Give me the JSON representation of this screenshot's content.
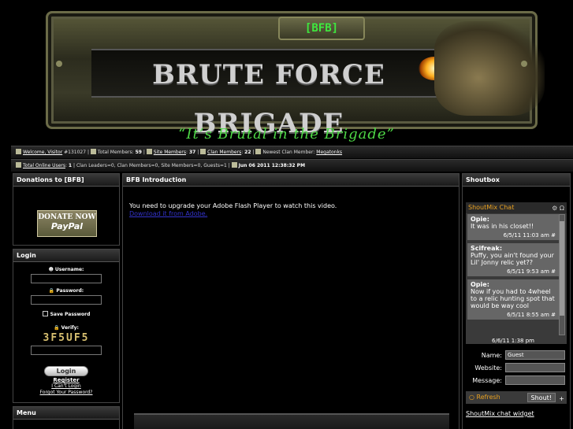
{
  "banner": {
    "tag": "[BFB]",
    "title": "BRUTE FORCE BRIGADE",
    "slogan": "“It’s Brutal in the Brigade”"
  },
  "infobar1": {
    "welcome": "Welcome, Visitor",
    "visitor_id": "#131027",
    "total_members_label": "Total Members:",
    "total_members": "59",
    "site_members_label": "Site Members",
    "site_members": "37",
    "clan_members_label": "Clan Members",
    "clan_members": "22",
    "newest_label": "Newest Clan Member:",
    "newest": "Megatonks"
  },
  "infobar2": {
    "online_label": "Total Online Users",
    "online": "1",
    "leaders": "Clan Leaders=0",
    "clan_members": "Clan Members=0",
    "site_members": "Site Members=0",
    "guests": "Guests=1",
    "datetime": "Jun 06 2011 12:38:32 PM"
  },
  "donate": {
    "title": "Donations to [BFB]",
    "btn_top": "DONATE NOW",
    "btn_bottom": "PayPal"
  },
  "login": {
    "title": "Login",
    "username": "Username:",
    "password": "Password:",
    "save": "Save Password",
    "verify": "Verify:",
    "captcha": "3F5UF5",
    "button": "Login",
    "register": "Register",
    "cant_login": "I Can't Login",
    "forgot": "Forgot Your Password?"
  },
  "menu": {
    "title": "Menu"
  },
  "center": {
    "title": "BFB Introduction",
    "flash_msg": "You need to upgrade your Adobe Flash Player to watch this video.",
    "download": "Download it from Adobe."
  },
  "shoutbox": {
    "title": "Shoutbox",
    "chat_title": "ShoutMix Chat",
    "ctrl": "⚙ Ω",
    "messages": [
      {
        "who": "Opie:",
        "text": "It was in his closet!!",
        "when": "6/5/11 11:03 am #"
      },
      {
        "who": "Scifreak:",
        "text": "Puffy, you ain't found your Lil' Jonny relic yet??",
        "when": "6/5/11 9:53 am #"
      },
      {
        "who": "Opie:",
        "text": "Now if you had to 4wheel to a relic hunting spot that would be way cool",
        "when": "6/5/11 8:55 am #"
      }
    ],
    "last": "6/6/11 1:38 pm",
    "name_label": "Name:",
    "name_value": "Guest",
    "website_label": "Website:",
    "message_label": "Message:",
    "refresh": "Refresh",
    "shout_btn": "Shout!",
    "plus": "+",
    "widget": "ShoutMix chat widget"
  }
}
